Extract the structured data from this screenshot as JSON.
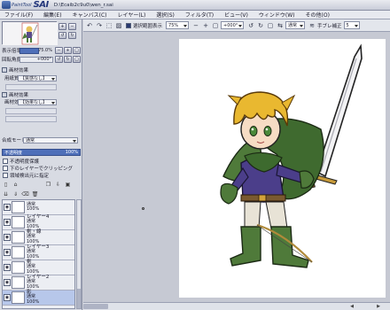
{
  "window": {
    "logo_small": "PaintTool",
    "logo_big": "SAI",
    "file_path": "D:\\Ecaib2c9u0\\wen_r.sai"
  },
  "menu": [
    "ファイル(F)",
    "編集(E)",
    "キャンバス(C)",
    "レイヤー(L)",
    "選択(S)",
    "フィルタ(T)",
    "ビュー(V)",
    "ウィンドウ(W)",
    "その他(O)"
  ],
  "navigator": {
    "zoom_label": "表示倍率",
    "zoom_value": "75.0%",
    "angle_label": "回転角度",
    "angle_value": "+000°"
  },
  "paper_effect": {
    "section_title": "画材効果",
    "texture_label": "用紙質感",
    "texture_value": "【質感なし】",
    "effect_section_title": "画材効果",
    "effect_label": "画材効果",
    "effect_value": "【効果なし】"
  },
  "layer_props": {
    "mode_label": "合成モード",
    "mode_value": "通常",
    "opacity_label": "不透明度",
    "opacity_value": "100%",
    "options": [
      "不透明度保護",
      "下のレイヤーでクリッピング",
      "領域検出元に指定"
    ]
  },
  "layers": [
    {
      "name": "",
      "mode": "通常",
      "opacity": "100%"
    },
    {
      "name": "レイヤー4",
      "mode": "通常",
      "opacity": "100%"
    },
    {
      "name": "剣・線",
      "mode": "通常",
      "opacity": "100%"
    },
    {
      "name": "レイヤー3",
      "mode": "通常",
      "opacity": "100%"
    },
    {
      "name": "剣",
      "mode": "通常",
      "opacity": "100%"
    },
    {
      "name": "レイヤー2",
      "mode": "通常",
      "opacity": "100%"
    },
    {
      "name": "影",
      "mode": "通常",
      "opacity": "100%"
    }
  ],
  "toolbar": {
    "selection_outline_label": "選択範囲表示",
    "zoom_value": "75%",
    "angle_value": "+000°",
    "blend_mode_value": "通常",
    "stabilizer_label": "手ブレ補正",
    "stabilizer_value": "5"
  },
  "colors": {
    "accent": "#4e6fb9",
    "selected_layer": "#b7c7ea",
    "canvas_bg": "#c6c9d3"
  }
}
